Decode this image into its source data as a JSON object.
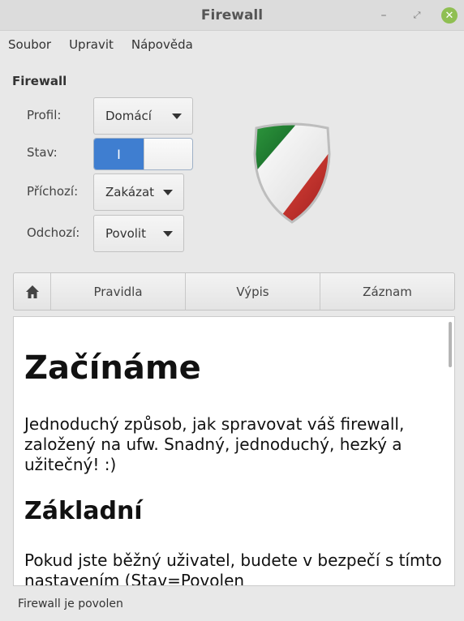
{
  "window": {
    "title": "Firewall"
  },
  "menu": [
    "Soubor",
    "Upravit",
    "Nápověda"
  ],
  "firewall": {
    "section_title": "Firewall",
    "profile": {
      "label": "Profil:",
      "value": "Domácí"
    },
    "status": {
      "label": "Stav:",
      "state_text": "I",
      "enabled": true
    },
    "incoming": {
      "label": "Příchozí:",
      "value": "Zakázat"
    },
    "outgoing": {
      "label": "Odchozí:",
      "value": "Povolit"
    }
  },
  "tabs": {
    "home_icon": "home-icon",
    "items": [
      "Pravidla",
      "Výpis",
      "Záznam"
    ]
  },
  "content": {
    "heading": "Začínáme",
    "intro": "Jednoduchý způsob, jak spravovat váš firewall, založený na ufw. Snadný, jednoduchý, hezký a užitečný! :)",
    "subheading": "Základní",
    "basic_text": "Pokud jste běžný uživatel, budete v bezpečí s tímto nastavením (Stav=Povolen"
  },
  "status_bar": {
    "text": "Firewall je povolen"
  },
  "colors": {
    "switch_on": "#3f7ed0",
    "close_button": "#8fbf52"
  }
}
